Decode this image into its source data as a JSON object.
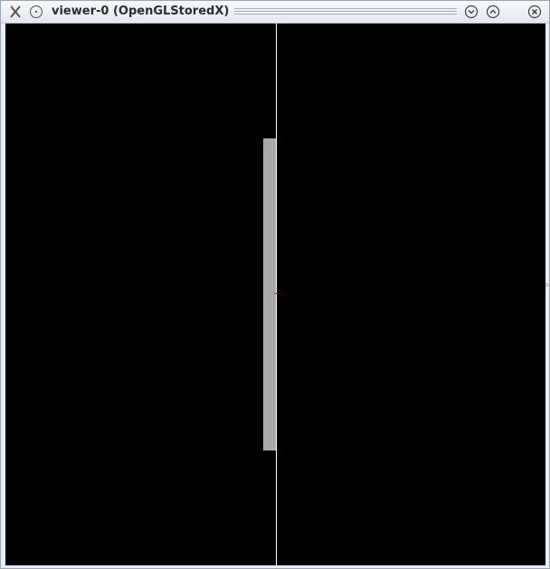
{
  "window": {
    "title": "viewer-0 (OpenGLStoredX)",
    "icons": {
      "app": "tools-icon",
      "menu": "window-menu-icon",
      "minimize": "chevron-down-icon",
      "maximize": "chevron-up-icon",
      "close": "close-icon"
    },
    "colors": {
      "titlebar": "#e3e7ee",
      "viewport_background": "#000000",
      "axis_line": "#ffffff",
      "detector_bar": "#a9a9a9",
      "origin_marker": "#cc2222"
    }
  }
}
